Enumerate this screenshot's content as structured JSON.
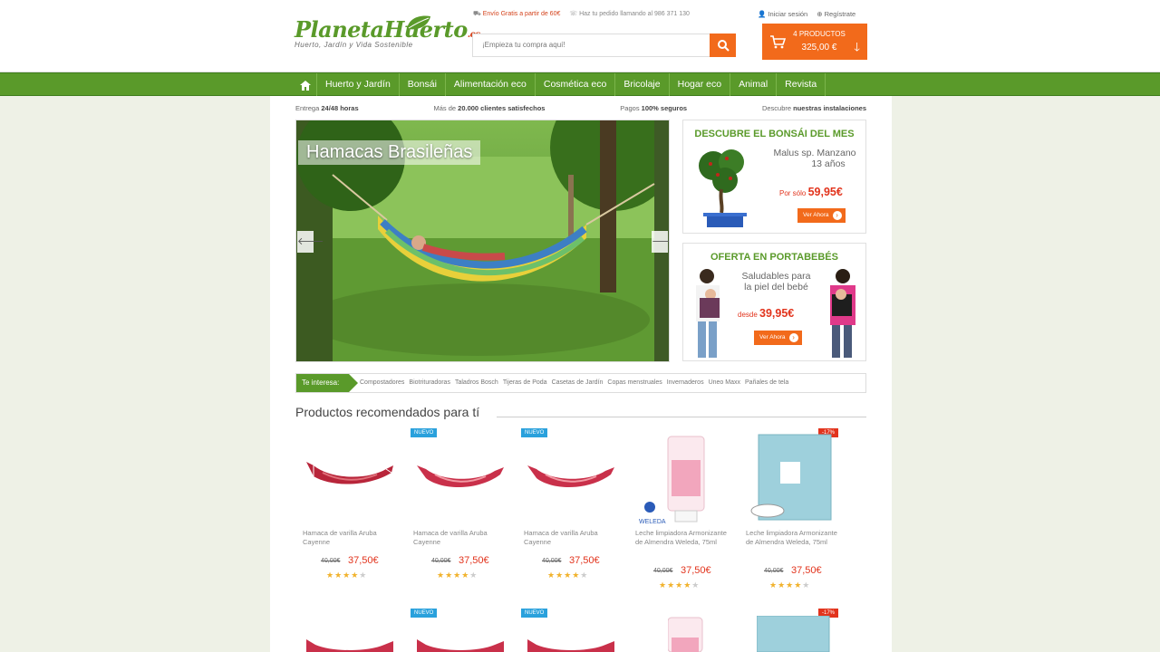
{
  "brand": {
    "name": "PlanetaHuerto",
    "tld": ".es",
    "tagline": "Huerto, Jardín y Vida Sostenible"
  },
  "top_links": {
    "shipping": "Envío Gratis a partir de 60€",
    "phone": "Haz tu pedido llamando al 986 371 130",
    "login": "Iniciar sesión",
    "register": "Regístrate"
  },
  "search": {
    "placeholder": "¡Empieza tu compra aquí!"
  },
  "cart": {
    "count_label": "4 PRODUCTOS",
    "total": "325,00 €"
  },
  "nav": {
    "items": [
      "Huerto y Jardín",
      "Bonsái",
      "Alimentación eco",
      "Cosmética eco",
      "Bricolaje",
      "Hogar eco",
      "Animal",
      "Revista"
    ]
  },
  "benefits": [
    {
      "pre": "Entrega ",
      "bold": "24/48 horas",
      "post": ""
    },
    {
      "pre": "Más de ",
      "bold": "20.000 clientes satisfechos",
      "post": ""
    },
    {
      "pre": "Pagos ",
      "bold": "100% seguros",
      "post": ""
    },
    {
      "pre": "Descubre ",
      "bold": "nuestras instalaciones",
      "post": ""
    }
  ],
  "hero": {
    "title": "Hamacas Brasileñas"
  },
  "promo_bonsai": {
    "heading": "DESCUBRE EL BONSÁI DEL MES",
    "line1": "Malus sp. Manzano",
    "line2": "13 años",
    "price_prefix": "Por sólo",
    "price": "59,95€",
    "cta": "Ver Ahora"
  },
  "promo_portabebes": {
    "heading": "OFERTA EN PORTABEBÉS",
    "line1": "Saludables para",
    "line2": "la piel del bebé",
    "price_prefix": "desde",
    "price": "39,95€",
    "cta": "Ver Ahora"
  },
  "interest": {
    "label": "Te interesa:",
    "links": [
      "Compostadores",
      "Biotrituradoras",
      "Taladros Bosch",
      "Tijeras de Poda",
      "Casetas de Jardín",
      "Copas menstruales",
      "Invernaderos",
      "Uneo Maxx",
      "Pañales de tela"
    ]
  },
  "recommended": {
    "title": "Productos recomendados para tí",
    "products": [
      {
        "name": "Hamaca de varilla Aruba Cayenne",
        "old": "40,00€",
        "price": "37,50€",
        "badge": "",
        "rating": 4
      },
      {
        "name": "Hamaca de varilla Aruba Cayenne",
        "old": "40,00€",
        "price": "37,50€",
        "badge": "NUEVO",
        "rating": 4
      },
      {
        "name": "Hamaca de varilla Aruba Cayenne",
        "old": "40,00€",
        "price": "37,50€",
        "badge": "NUEVO",
        "rating": 4
      },
      {
        "name": "Leche limpiadora Armonizante de Almendra Weleda, 75ml",
        "old": "40,00€",
        "price": "37,50€",
        "badge": "",
        "rating": 4
      },
      {
        "name": "Leche limpiadora Armonizante de Almendra Weleda, 75ml",
        "old": "40,00€",
        "price": "37,50€",
        "badge": "-17%",
        "rating": 4
      }
    ],
    "row2_badges": [
      "",
      "NUEVO",
      "NUEVO",
      "",
      "-17%"
    ]
  },
  "colors": {
    "green": "#5a9a2a",
    "orange": "#f26a1b",
    "red": "#e2341d",
    "blue": "#2aa1dc"
  }
}
